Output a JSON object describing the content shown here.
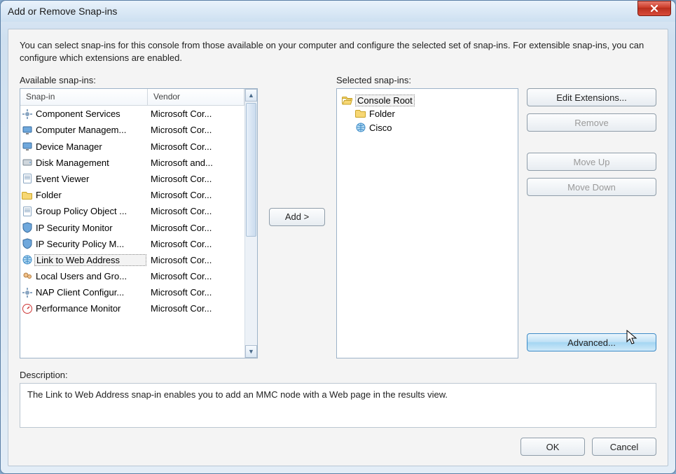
{
  "window": {
    "title": "Add or Remove Snap-ins"
  },
  "intro": "You can select snap-ins for this console from those available on your computer and configure the selected set of snap-ins. For extensible snap-ins, you can configure which extensions are enabled.",
  "available": {
    "label": "Available snap-ins:",
    "headers": {
      "snapin": "Snap-in",
      "vendor": "Vendor"
    },
    "rows": [
      {
        "name": "Component Services",
        "vendor": "Microsoft Cor...",
        "icon": "component-services"
      },
      {
        "name": "Computer Managem...",
        "vendor": "Microsoft Cor...",
        "icon": "computer-management"
      },
      {
        "name": "Device Manager",
        "vendor": "Microsoft Cor...",
        "icon": "device-manager"
      },
      {
        "name": "Disk Management",
        "vendor": "Microsoft and...",
        "icon": "disk-management"
      },
      {
        "name": "Event Viewer",
        "vendor": "Microsoft Cor...",
        "icon": "event-viewer"
      },
      {
        "name": "Folder",
        "vendor": "Microsoft Cor...",
        "icon": "folder"
      },
      {
        "name": "Group Policy Object ...",
        "vendor": "Microsoft Cor...",
        "icon": "group-policy"
      },
      {
        "name": "IP Security Monitor",
        "vendor": "Microsoft Cor...",
        "icon": "ip-sec-monitor"
      },
      {
        "name": "IP Security Policy M...",
        "vendor": "Microsoft Cor...",
        "icon": "ip-sec-policy"
      },
      {
        "name": "Link to Web Address",
        "vendor": "Microsoft Cor...",
        "icon": "web-link",
        "selected": true
      },
      {
        "name": "Local Users and Gro...",
        "vendor": "Microsoft Cor...",
        "icon": "local-users"
      },
      {
        "name": "NAP Client Configur...",
        "vendor": "Microsoft Cor...",
        "icon": "nap-client"
      },
      {
        "name": "Performance Monitor",
        "vendor": "Microsoft Cor...",
        "icon": "performance"
      }
    ]
  },
  "add_button": "Add >",
  "selected": {
    "label": "Selected snap-ins:",
    "root": "Console Root",
    "children": [
      {
        "name": "Folder",
        "icon": "folder"
      },
      {
        "name": "Cisco",
        "icon": "web-link"
      }
    ]
  },
  "side_buttons": {
    "edit_extensions": "Edit Extensions...",
    "remove": "Remove",
    "move_up": "Move Up",
    "move_down": "Move Down",
    "advanced": "Advanced..."
  },
  "description": {
    "label": "Description:",
    "text": "The Link to Web Address snap-in enables you to add an MMC node with a Web page in the results view."
  },
  "footer": {
    "ok": "OK",
    "cancel": "Cancel"
  }
}
